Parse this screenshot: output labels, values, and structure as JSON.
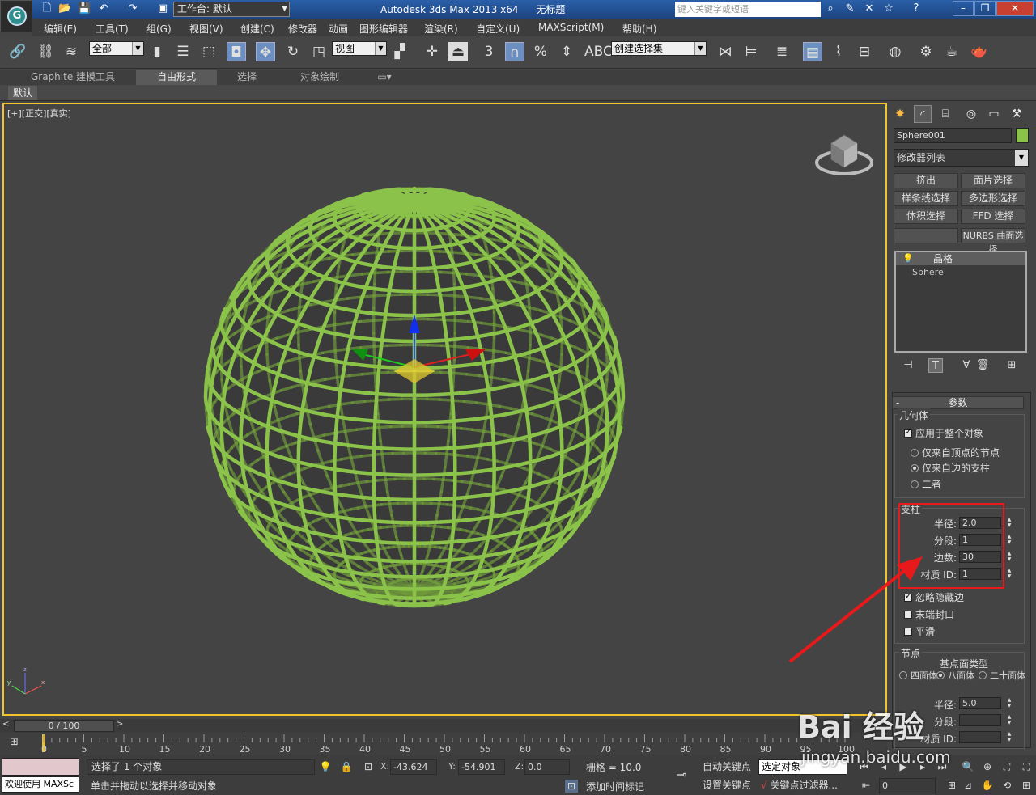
{
  "titlebar": {
    "workspace_label": "工作台: 默认",
    "app_title": "Autodesk 3ds Max  2013 x64",
    "doc_title": "无标题",
    "search_placeholder": "键入关键字或短语"
  },
  "menu": [
    "编辑(E)",
    "工具(T)",
    "组(G)",
    "视图(V)",
    "创建(C)",
    "修改器",
    "动画",
    "图形编辑器",
    "渲染(R)",
    "自定义(U)",
    "MAXScript(M)",
    "帮助(H)"
  ],
  "toolbar": {
    "selection_filter": "全部",
    "ref_coord": "视图",
    "snap_angle_label": "3",
    "named_selection": "创建选择集"
  },
  "ribbon": {
    "tabs": [
      "Graphite 建模工具",
      "自由形式",
      "选择",
      "对象绘制"
    ],
    "active_tab": "自由形式",
    "sub_tab": "默认"
  },
  "viewport": {
    "label": "[+][正交][真实]",
    "wire_color": "#8bc34a"
  },
  "command_panel": {
    "object_name": "Sphere001",
    "object_color": "#8bc34a",
    "modifier_list": "修改器列表",
    "modifier_buttons": [
      "挤出",
      "面片选择",
      "样条线选择",
      "多边形选择",
      "体积选择",
      "FFD 选择",
      "",
      "NURBS 曲面选择"
    ],
    "stack": [
      "晶格",
      "Sphere"
    ],
    "params_title": "参数",
    "geometry": {
      "title": "几何体",
      "apply_whole": "应用于整个对象",
      "apply_whole_checked": true,
      "options": [
        "仅来自顶点的节点",
        "仅来自边的支柱",
        "二者"
      ],
      "selected_option": 1
    },
    "struts": {
      "title": "支柱",
      "fields": [
        {
          "label": "半径:",
          "value": "2.0"
        },
        {
          "label": "分段:",
          "value": "1"
        },
        {
          "label": "边数:",
          "value": "30"
        },
        {
          "label": "材质 ID:",
          "value": "1"
        }
      ],
      "checkboxes": [
        {
          "label": "忽略隐藏边",
          "checked": true
        },
        {
          "label": "末端封口",
          "checked": false
        },
        {
          "label": "平滑",
          "checked": false
        }
      ]
    },
    "joints": {
      "title": "节点",
      "type_label": "基点面类型",
      "types": [
        "四面体",
        "八面体",
        "二十面体"
      ],
      "selected_type": 1,
      "radius_label": "半径:",
      "radius_value": "5.0",
      "segments_label": "分段:",
      "material_label": "材质 ID:"
    },
    "highlight_color": "#e8191a"
  },
  "timeline": {
    "slider_label": "0 / 100",
    "ticks": [
      "0",
      "5",
      "10",
      "15",
      "20",
      "25",
      "30",
      "35",
      "40",
      "45",
      "50",
      "55",
      "60",
      "65",
      "70",
      "75",
      "80",
      "85",
      "90",
      "95",
      "100"
    ]
  },
  "status": {
    "maxscript": "欢迎使用 MAXSc",
    "selection_text": "选择了 1 个对象",
    "prompt_text": "单击并拖动以选择并移动对象",
    "x_label": "X:",
    "x_value": "-43.624",
    "y_label": "Y:",
    "y_value": "-54.901",
    "z_label": "Z:",
    "z_value": "0.0",
    "grid": "栅格 = 10.0",
    "add_time_tag": "添加时间标记",
    "auto_key": "自动关键点",
    "set_key": "设置关键点",
    "key_mode": "选定对象",
    "key_filters": "关键点过滤器...",
    "frame": "0"
  },
  "watermark": {
    "logo": "Bai 经验",
    "url": "jingyan.baidu.com"
  }
}
